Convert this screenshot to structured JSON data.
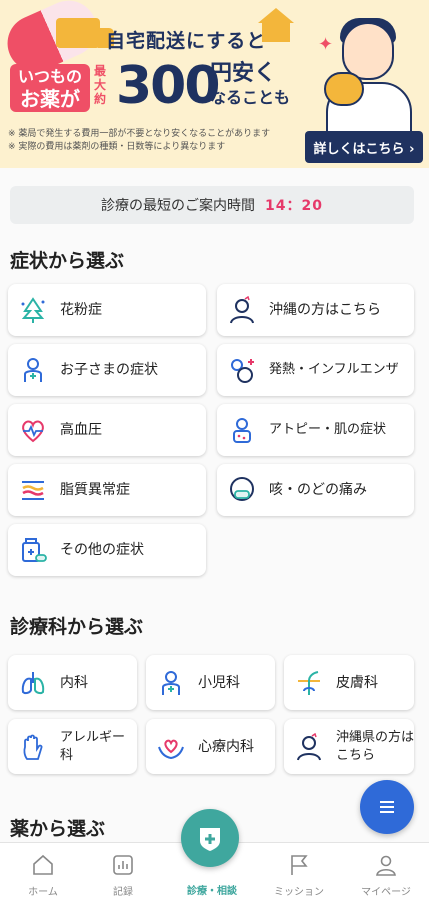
{
  "banner": {
    "headline": "自宅配送にすると",
    "box_line1": "いつもの",
    "box_line2": "お薬が",
    "max_label": "最大約",
    "amount": "300",
    "tail_line1": "円安く",
    "tail_line2": "なることも",
    "note1": "※ 薬局で発生する費用一部が不要となり安くなることがあります",
    "note2": "※ 実際の費用は薬剤の種類・日数等により異なります",
    "cta_label": "詳しくはこちら ›"
  },
  "wait_time": {
    "label": "診療の最短のご案内時間",
    "value": "14：20"
  },
  "symptoms": {
    "title": "症状から選ぶ",
    "items": [
      {
        "label": "花粉症",
        "icon": "pollen-tree-icon"
      },
      {
        "label": "沖縄の方はこちら",
        "icon": "okinawa-person-icon"
      },
      {
        "label": "お子さまの症状",
        "icon": "child-icon"
      },
      {
        "label": "発熱・インフルエンザ",
        "icon": "fever-virus-icon"
      },
      {
        "label": "高血圧",
        "icon": "heart-pulse-icon"
      },
      {
        "label": "アトピー・肌の症状",
        "icon": "skin-person-icon"
      },
      {
        "label": "脂質異常症",
        "icon": "lipid-layers-icon"
      },
      {
        "label": "咳・のどの痛み",
        "icon": "mask-face-icon"
      },
      {
        "label": "その他の症状",
        "icon": "medicine-box-icon"
      }
    ]
  },
  "departments": {
    "title": "診療科から選ぶ",
    "items": [
      {
        "label": "内科",
        "icon": "lungs-icon"
      },
      {
        "label": "小児科",
        "icon": "child-icon"
      },
      {
        "label": "皮膚科",
        "icon": "hair-follicle-icon"
      },
      {
        "label": "アレルギー科",
        "icon": "hand-icon"
      },
      {
        "label": "心療内科",
        "icon": "heart-hands-icon"
      },
      {
        "label": "沖縄県の方は\nこちら",
        "icon": "okinawa-person-icon"
      }
    ]
  },
  "medicine": {
    "title": "薬から選ぶ"
  },
  "nav": {
    "home": "ホーム",
    "records": "記録",
    "consult": "診療・相談",
    "missions": "ミッション",
    "mypage": "マイページ"
  },
  "colors": {
    "accent": "#3fa79e",
    "time": "#e6396a",
    "fab": "#2f6ad8",
    "navy": "#1f3260"
  }
}
